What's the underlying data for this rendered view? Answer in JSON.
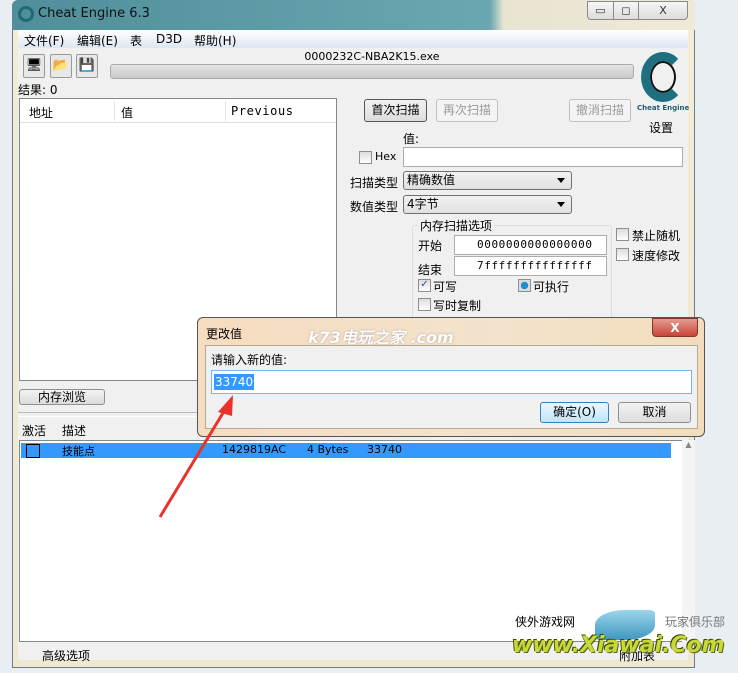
{
  "window": {
    "title": "Cheat Engine 6.3",
    "minimize": "▭",
    "maximize": "◻",
    "close": "X"
  },
  "menu": [
    "文件(F)",
    "编辑(E)",
    "表",
    "D3D",
    "帮助(H)"
  ],
  "process": "0000232C-NBA2K15.exe",
  "results": "结果: 0",
  "logo_text": "Cheat Engine",
  "settings": "设置",
  "found_list": {
    "columns": [
      "地址",
      "值",
      "Previous"
    ]
  },
  "scan": {
    "first": "首次扫描",
    "next": "再次扫描",
    "undo": "撤消扫描",
    "value_label": "值:",
    "hex": "Hex",
    "value": "",
    "scan_type_label": "扫描类型",
    "scan_type": "精确数值",
    "value_type_label": "数值类型",
    "value_type": "4字节"
  },
  "mem_options": {
    "title": "内存扫描选项",
    "start_label": "开始",
    "start": "0000000000000000",
    "end_label": "结束",
    "end": "7fffffffffffffff",
    "writable": "可写",
    "executable": "可执行",
    "copy_on_write": "写时复制",
    "no_random": "禁止随机",
    "speedhack": "速度修改"
  },
  "memory_view": "内存浏览",
  "table": {
    "columns": [
      "激活",
      "描述"
    ],
    "rows": [
      {
        "description": "技能点",
        "address": "1429819AC",
        "type": "4 Bytes",
        "value": "33740"
      }
    ]
  },
  "footer": {
    "advanced": "高级选项",
    "table_extras": "附加表"
  },
  "dialog": {
    "title": "更改值",
    "close": "X",
    "prompt": "请输入新的值:",
    "value": "33740",
    "ok": "确定(O)",
    "cancel": "取消"
  },
  "watermarks": {
    "k73": "k73电玩之家 .com",
    "xiawai_left": "侠外游戏网",
    "xiawai_right": "玩家俱乐部",
    "xiawai_url": "www.Xiawai.Com"
  },
  "colors": {
    "selection": "#3399ff",
    "arrow": "#e8322b",
    "close": "#c8453a"
  }
}
